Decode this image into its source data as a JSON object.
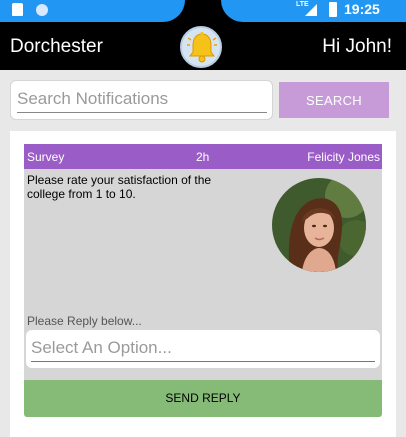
{
  "status_bar": {
    "network_label": "LTE",
    "time": "19:25"
  },
  "header": {
    "title": "Dorchester",
    "greeting": "Hi John!",
    "bell_icon": "bell-icon"
  },
  "search": {
    "placeholder": "Search Notifications",
    "value": "",
    "button_label": "SEARCH"
  },
  "notification": {
    "type": "Survey",
    "age": "2h",
    "author": "Felicity Jones",
    "question": "Please rate your satisfaction of the college from 1 to 10.",
    "reply_label": "Please Reply below...",
    "select_placeholder": "Select An Option...",
    "send_label": "SEND REPLY"
  },
  "colors": {
    "status_bar": "#2196f3",
    "card_header": "#9a5cc6",
    "search_button": "#c79ad8",
    "send_button": "#86ba77"
  }
}
